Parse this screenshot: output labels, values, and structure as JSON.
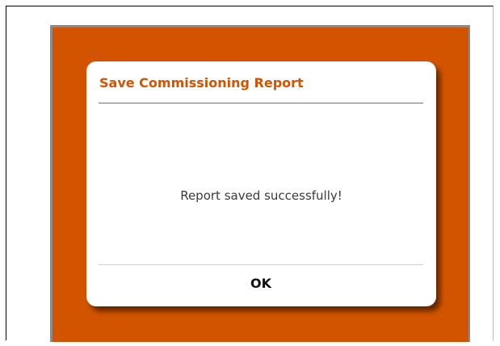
{
  "dialog": {
    "title": "Save Commissioning Report",
    "message": "Report saved successfully!",
    "ok_label": "OK"
  },
  "colors": {
    "accent": "#d35400",
    "background_screen": "#d35400",
    "dialog_background": "#ffffff",
    "message_text": "#3a3a3a",
    "button_text": "#111111"
  }
}
